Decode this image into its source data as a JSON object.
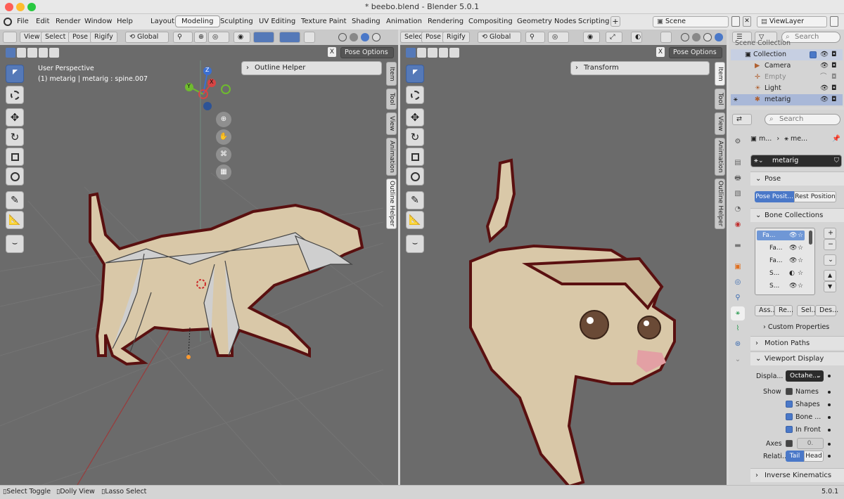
{
  "window": {
    "title": "* beebo.blend - Blender 5.0.1"
  },
  "menu": [
    "File",
    "Edit",
    "Render",
    "Window",
    "Help"
  ],
  "workspaces": [
    "Layout",
    "Modeling",
    "Sculpting",
    "UV Editing",
    "Texture Paint",
    "Shading",
    "Animation",
    "Rendering",
    "Compositing",
    "Geometry Nodes",
    "Scripting"
  ],
  "active_workspace": "Modeling",
  "scene": "Scene",
  "view_layer": "ViewLayer",
  "left_viewport": {
    "header": {
      "view": "View",
      "select": "Select",
      "pose": "Pose",
      "rigify": "Rigify",
      "orientation": "Global",
      "pose_options": "Pose Options"
    },
    "info_line1": "User Perspective",
    "info_line2": "(1) metarig | metarig : spine.007",
    "panel_title": "Outline Helper",
    "ntabs": [
      "Item",
      "Tool",
      "View",
      "Animation",
      "Outline Helper"
    ],
    "gizmo": {
      "z": "Z",
      "y": "Y",
      "x": "X"
    }
  },
  "right_viewport": {
    "header": {
      "select": "Select",
      "pose": "Pose",
      "rigify": "Rigify",
      "orientation": "Global",
      "pose_options": "Pose Options"
    },
    "panel_title": "Transform",
    "ntabs": [
      "Item",
      "Tool",
      "View",
      "Animation",
      "Outline Helper"
    ]
  },
  "outliner": {
    "search_placeholder": "Search",
    "top": "Scene Collection",
    "collection": "Collection",
    "items": [
      "Camera",
      "Empty",
      "Light",
      "metarig"
    ]
  },
  "properties": {
    "search_placeholder": "Search",
    "breadcrumb_a": "m...",
    "breadcrumb_b": "me...",
    "object_name": "metarig",
    "pose": {
      "header": "Pose",
      "pose_position": "Pose Posit...",
      "rest_position": "Rest Position"
    },
    "bone_collections": {
      "header": "Bone Collections",
      "items": [
        "Fa...",
        "Fa...",
        "Fa...",
        "S...",
        "S..."
      ],
      "assign": "Ass...",
      "remove": "Re...",
      "select": "Sel...",
      "deselect": "Des...",
      "custom_props": "Custom Properties"
    },
    "motion_paths": "Motion Paths",
    "viewport_display": {
      "header": "Viewport Display",
      "display_label": "Displa...",
      "display_value": "Octahe...",
      "show_label": "Show",
      "names": "Names",
      "shapes": "Shapes",
      "bone": "Bone ...",
      "in_front": "In Front",
      "axes_label": "Axes",
      "axes_value": "0.",
      "relation_label": "Relati...",
      "tail": "Tail",
      "head": "Head"
    },
    "inverse_kinematics": "Inverse Kinematics"
  },
  "status": {
    "select_toggle": "Select Toggle",
    "dolly_view": "Dolly View",
    "lasso_select": "Lasso Select",
    "version": "5.0.1"
  },
  "colors": {
    "accent": "#4a78c8",
    "viewport_bg": "#6b6b6b",
    "dog": "#d9c8a8",
    "outline": "#5a1010"
  }
}
